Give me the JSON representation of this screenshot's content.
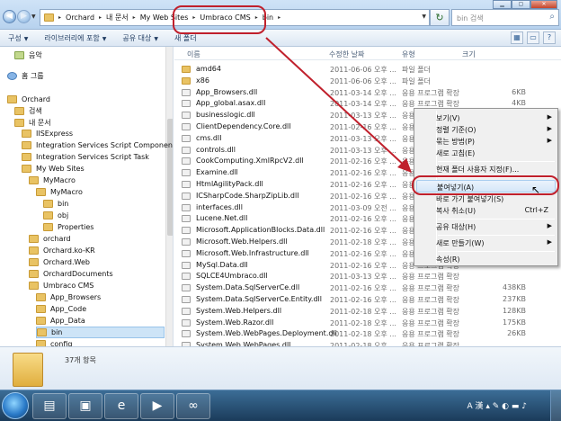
{
  "address": {
    "crumbs": [
      "Orchard",
      "내 문서",
      "My Web Sites",
      "Umbraco CMS",
      "bin"
    ],
    "search_placeholder": "bin 검색"
  },
  "toolbar": {
    "organize": "구성",
    "library": "라이브러리에 포함",
    "share": "공유 대상",
    "new_folder": "새 폴더"
  },
  "nav": {
    "items": [
      {
        "label": "음악",
        "level": 1
      },
      {
        "label": "홈 그룹",
        "level": 0
      },
      {
        "label": "Orchard",
        "level": 0
      },
      {
        "label": "검색",
        "level": 1
      },
      {
        "label": "내 문서",
        "level": 1
      },
      {
        "label": "IISExpress",
        "level": 2
      },
      {
        "label": "Integration Services Script Component",
        "level": 2
      },
      {
        "label": "Integration Services Script Task",
        "level": 2
      },
      {
        "label": "My Web Sites",
        "level": 2
      },
      {
        "label": "MyMacro",
        "level": 3
      },
      {
        "label": "MyMacro",
        "level": 4
      },
      {
        "label": "bin",
        "level": 5
      },
      {
        "label": "obj",
        "level": 5
      },
      {
        "label": "Properties",
        "level": 5
      },
      {
        "label": "orchard",
        "level": 3
      },
      {
        "label": "Orchard.ko-KR",
        "level": 3
      },
      {
        "label": "Orchard.Web",
        "level": 3
      },
      {
        "label": "OrchardDocuments",
        "level": 3
      },
      {
        "label": "Umbraco CMS",
        "level": 3
      },
      {
        "label": "App_Browsers",
        "level": 4
      },
      {
        "label": "App_Code",
        "level": 4
      },
      {
        "label": "App_Data",
        "level": 4
      },
      {
        "label": "bin",
        "level": 4
      },
      {
        "label": "config",
        "level": 4
      }
    ]
  },
  "columns": {
    "name": "이름",
    "date": "수정한 날짜",
    "type": "유형",
    "size": "크기"
  },
  "files": [
    {
      "name": "amd64",
      "date": "2011-06-06 오후 ...",
      "type": "파일 폴더",
      "size": "",
      "kind": "folder"
    },
    {
      "name": "x86",
      "date": "2011-06-06 오후 ...",
      "type": "파일 폴더",
      "size": "",
      "kind": "folder"
    },
    {
      "name": "App_Browsers.dll",
      "date": "2011-03-14 오후 ...",
      "type": "응용 프로그램 확장",
      "size": "6KB",
      "kind": "dll"
    },
    {
      "name": "App_global.asax.dll",
      "date": "2011-03-14 오후 ...",
      "type": "응용 프로그램 확장",
      "size": "4KB",
      "kind": "dll"
    },
    {
      "name": "businesslogic.dll",
      "date": "2011-03-13 오후 ...",
      "type": "응용 프로그램 확장",
      "size": "",
      "kind": "dll"
    },
    {
      "name": "ClientDependency.Core.dll",
      "date": "2011-02-16 오후 ...",
      "type": "응용 프로그램 확장",
      "size": "",
      "kind": "dll"
    },
    {
      "name": "cms.dll",
      "date": "2011-03-13 오후 ...",
      "type": "응용 프로그램 확장",
      "size": "",
      "kind": "dll"
    },
    {
      "name": "controls.dll",
      "date": "2011-03-13 오후 ...",
      "type": "응용 프로그램 확장",
      "size": "",
      "kind": "dll"
    },
    {
      "name": "CookComputing.XmlRpcV2.dll",
      "date": "2011-02-16 오후 ...",
      "type": "응용 프로그램 확장",
      "size": "",
      "kind": "dll"
    },
    {
      "name": "Examine.dll",
      "date": "2011-02-16 오후 ...",
      "type": "응용 프로그램 확장",
      "size": "",
      "kind": "dll"
    },
    {
      "name": "HtmlAgilityPack.dll",
      "date": "2011-02-16 오후 ...",
      "type": "응용 프로그램 확장",
      "size": "",
      "kind": "dll"
    },
    {
      "name": "ICSharpCode.SharpZipLib.dll",
      "date": "2011-02-16 오후 ...",
      "type": "응용 프로그램 확장",
      "size": "",
      "kind": "dll"
    },
    {
      "name": "interfaces.dll",
      "date": "2011-03-09 오전 ...",
      "type": "응용 프로그램 확장",
      "size": "",
      "kind": "dll"
    },
    {
      "name": "Lucene.Net.dll",
      "date": "2011-02-16 오후 ...",
      "type": "응용 프로그램 확장",
      "size": "",
      "kind": "dll"
    },
    {
      "name": "Microsoft.ApplicationBlocks.Data.dll",
      "date": "2011-02-16 오후 ...",
      "type": "응용 프로그램 확장",
      "size": "",
      "kind": "dll"
    },
    {
      "name": "Microsoft.Web.Helpers.dll",
      "date": "2011-02-18 오후 ...",
      "type": "응용 프로그램 확장",
      "size": "",
      "kind": "dll"
    },
    {
      "name": "Microsoft.Web.Infrastructure.dll",
      "date": "2011-02-16 오후 ...",
      "type": "응용 프로그램 확장",
      "size": "",
      "kind": "dll"
    },
    {
      "name": "MySql.Data.dll",
      "date": "2011-02-16 오후 ...",
      "type": "응용 프로그램 확장",
      "size": "",
      "kind": "dll"
    },
    {
      "name": "SQLCE4Umbraco.dll",
      "date": "2011-03-13 오후 ...",
      "type": "응용 프로그램 확장",
      "size": "",
      "kind": "dll"
    },
    {
      "name": "System.Data.SqlServerCe.dll",
      "date": "2011-02-16 오후 ...",
      "type": "응용 프로그램 확장",
      "size": "438KB",
      "kind": "dll"
    },
    {
      "name": "System.Data.SqlServerCe.Entity.dll",
      "date": "2011-02-16 오후 ...",
      "type": "응용 프로그램 확장",
      "size": "237KB",
      "kind": "dll"
    },
    {
      "name": "System.Web.Helpers.dll",
      "date": "2011-02-18 오후 ...",
      "type": "응용 프로그램 확장",
      "size": "128KB",
      "kind": "dll"
    },
    {
      "name": "System.Web.Razor.dll",
      "date": "2011-02-18 오후 ...",
      "type": "응용 프로그램 확장",
      "size": "175KB",
      "kind": "dll"
    },
    {
      "name": "System.Web.WebPages.Deployment.dll",
      "date": "2011-02-18 오후 ...",
      "type": "응용 프로그램 확장",
      "size": "26KB",
      "kind": "dll"
    },
    {
      "name": "System.Web.WebPages.dll",
      "date": "2011-02-18 오후 ...",
      "type": "응용 프로그램 확장",
      "size": "",
      "kind": "dll"
    }
  ],
  "details": {
    "count": "37개 항목"
  },
  "context_menu": {
    "view": "보기(V)",
    "sort": "정렬 기준(O)",
    "group": "묶는 방법(P)",
    "refresh": "새로 고침(E)",
    "customize": "현재 폴더 사용자 지정(F)...",
    "paste": "붙여넣기(A)",
    "paste_shortcut": "바로 가기 붙여넣기(S)",
    "undo": "복사 취소(U)",
    "undo_shortcut": "Ctrl+Z",
    "share": "공유 대상(H)",
    "new": "새로 만들기(W)",
    "properties": "속성(R)"
  },
  "taskbar": {
    "tray": "A 漢"
  },
  "colors": {
    "annotation": "#c0202c",
    "selection": "#cde4f7",
    "folder": "#e9c364"
  }
}
